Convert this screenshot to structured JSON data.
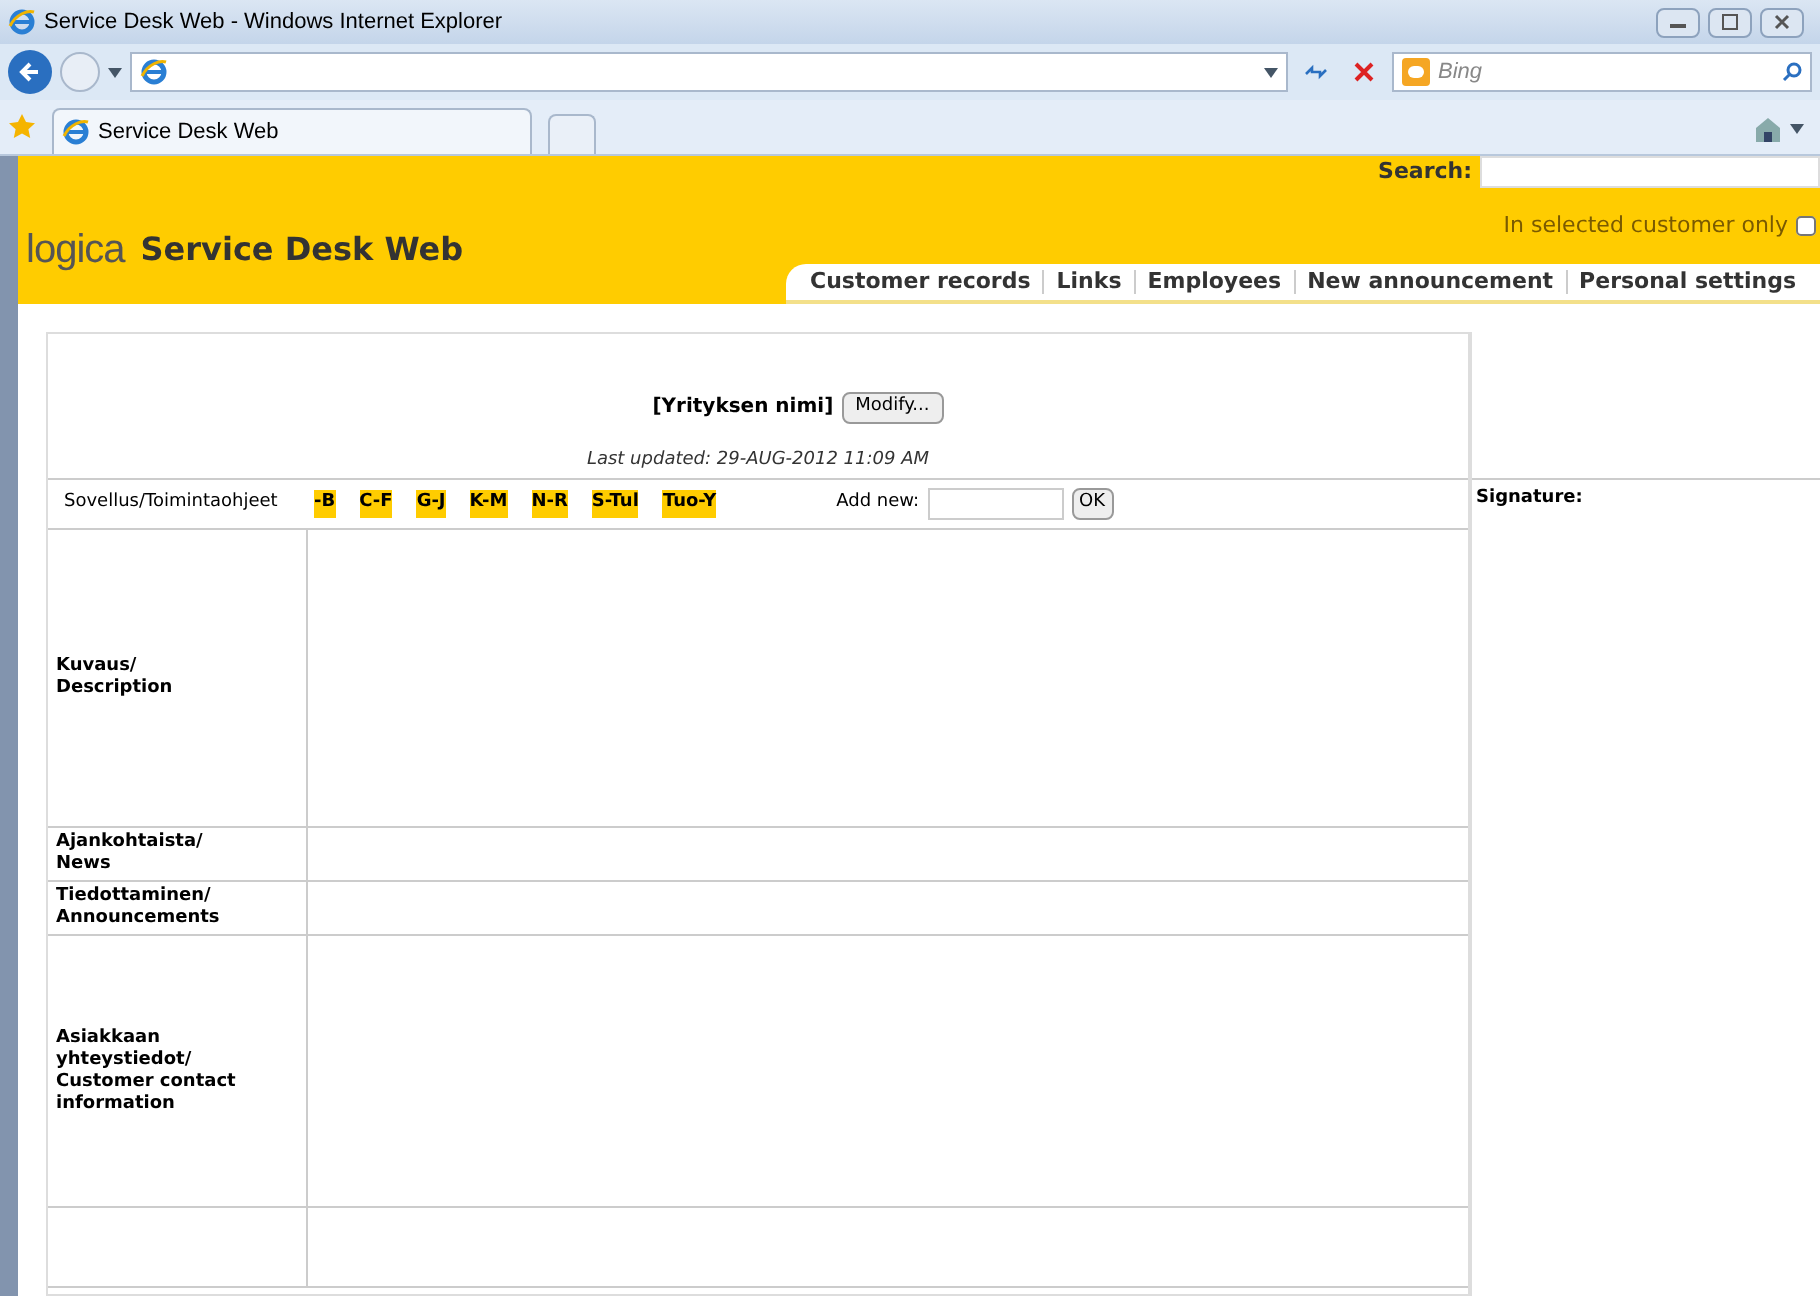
{
  "window": {
    "title": "Service Desk Web - Windows Internet Explorer"
  },
  "browser": {
    "search_placeholder": "Bing",
    "tab": "Service Desk Web"
  },
  "header": {
    "logo": "logica",
    "title": "Service Desk Web",
    "search_label": "Search:",
    "scope_label": "In selected customer only",
    "scope_checked": false
  },
  "nav": [
    "Customer records",
    "Links",
    "Employees",
    "New announcement",
    "Personal settings"
  ],
  "company": {
    "name": "[Yrityksen nimi]",
    "modify": "Modify...",
    "updated": "Last updated: 29-AUG-2012 11:09 AM"
  },
  "index": {
    "label": "Sovellus/Toimintaohjeet",
    "letters": [
      "-B",
      "C-F",
      "G-J",
      "K-M",
      "N-R",
      "S-Tul",
      "Tuo-Y"
    ],
    "add_label": "Add new:",
    "ok": "OK"
  },
  "signature": "Signature:",
  "rows": [
    {
      "label": "Kuvaus/\nDescription"
    },
    {
      "label": "Ajankohtaista/\nNews"
    },
    {
      "label": "Tiedottaminen/\nAnnouncements"
    },
    {
      "label": "Asiakkaan\nyhteystiedot/\nCustomer contact\ninformation"
    },
    {
      "label": ""
    }
  ]
}
